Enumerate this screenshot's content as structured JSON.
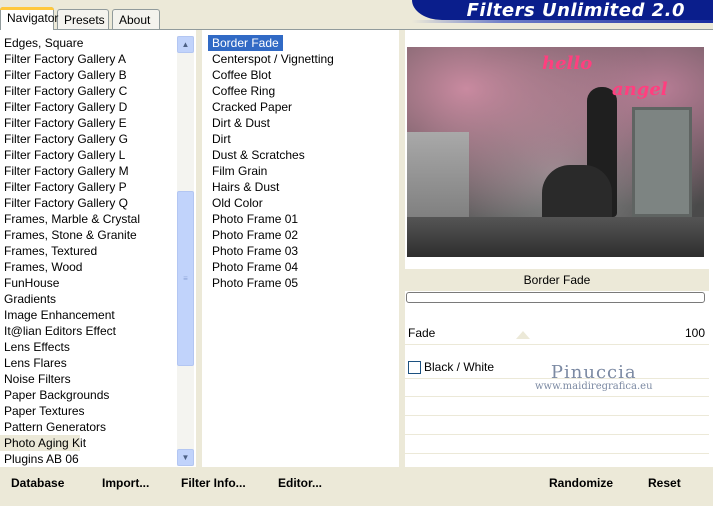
{
  "app": {
    "title": "Filters Unlimited 2.0"
  },
  "tabs": [
    {
      "label": "Navigator",
      "active": true
    },
    {
      "label": "Presets",
      "active": false
    },
    {
      "label": "About",
      "active": false
    }
  ],
  "categories": [
    "Edges, Square",
    "Filter Factory Gallery A",
    "Filter Factory Gallery B",
    "Filter Factory Gallery C",
    "Filter Factory Gallery D",
    "Filter Factory Gallery E",
    "Filter Factory Gallery G",
    "Filter Factory Gallery L",
    "Filter Factory Gallery M",
    "Filter Factory Gallery P",
    "Filter Factory Gallery Q",
    "Frames, Marble & Crystal",
    "Frames, Stone & Granite",
    "Frames, Textured",
    "Frames, Wood",
    "FunHouse",
    "Gradients",
    "Image Enhancement",
    "It@lian Editors Effect",
    "Lens Effects",
    "Lens Flares",
    "Noise Filters",
    "Paper Backgrounds",
    "Paper Textures",
    "Pattern Generators",
    "Photo Aging Kit",
    "Plugins AB 06"
  ],
  "selected_category": "Photo Aging Kit",
  "filters": [
    "Border Fade",
    "Centerspot / Vignetting",
    "Coffee Blot",
    "Coffee Ring",
    "Cracked Paper",
    "Dirt & Dust",
    "Dirt",
    "Dust & Scratches",
    "Film Grain",
    "Hairs & Dust",
    "Old Color",
    "Photo Frame 01",
    "Photo Frame 02",
    "Photo Frame 03",
    "Photo Frame 04",
    "Photo Frame 05"
  ],
  "selected_filter": "Border Fade",
  "preview": {
    "text1": "hello",
    "text2": "angel"
  },
  "params": {
    "filter_name": "Border Fade",
    "fade_label": "Fade",
    "fade_value": "100",
    "checkbox_label": "Black / White",
    "checkbox_checked": false
  },
  "watermark": {
    "line1": "Pinuccia",
    "line2": "www.maidiregrafica.eu"
  },
  "buttons": {
    "database": "Database",
    "import": "Import...",
    "filter_info": "Filter Info...",
    "editor": "Editor...",
    "randomize": "Randomize",
    "reset": "Reset"
  },
  "colors": {
    "banner": "#0a1e8c",
    "selection": "#316ac5",
    "window_bg": "#ece9d8"
  }
}
